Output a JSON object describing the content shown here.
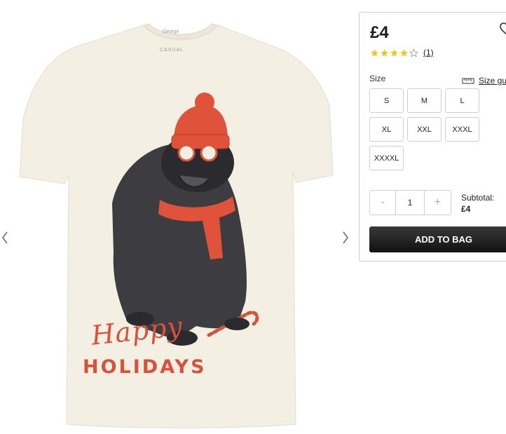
{
  "product": {
    "price": "£4",
    "rating": 4,
    "rating_max": 5,
    "review_count": "(1)",
    "shirt_brand_tag": "George",
    "shirt_casual_tag": "CASUAL",
    "print_text_line1": "Happy",
    "print_text_line2": "HOLIDAYS"
  },
  "size": {
    "label": "Size",
    "guide_label": "Size gu",
    "options": [
      "S",
      "M",
      "L",
      "XL",
      "XXL",
      "XXXL",
      "XXXXL"
    ]
  },
  "quantity": {
    "minus": "-",
    "value": "1",
    "plus": "+"
  },
  "subtotal": {
    "label": "Subtotal:",
    "value": "£4"
  },
  "actions": {
    "add_to_bag": "ADD TO BAG"
  },
  "icons": {
    "prev": "chevron-left-icon",
    "next": "chevron-right-icon",
    "wishlist": "heart-icon",
    "size_guide": "ruler-icon",
    "star": "star-icon"
  },
  "colors": {
    "star": "#f5c518",
    "button": "#1a1a1a",
    "print_red": "#d7513b",
    "shirt": "#f3efe2"
  }
}
